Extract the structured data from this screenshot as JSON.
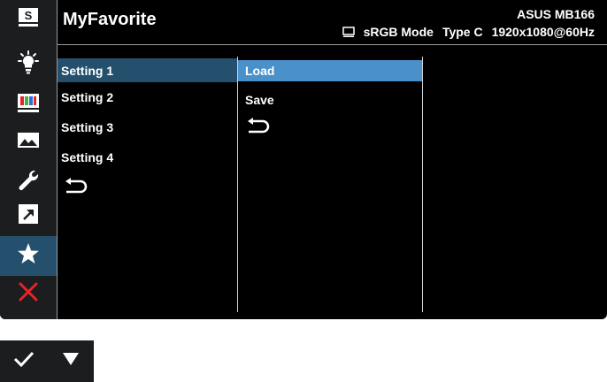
{
  "header": {
    "title": "MyFavorite",
    "model": "ASUS MB166",
    "mode": "sRGB Mode",
    "input": "Type C",
    "resolution": "1920x1080@60Hz"
  },
  "sidebar": {
    "items": [
      {
        "icon": "splendid-icon",
        "active": false
      },
      {
        "icon": "blue-light-filter-icon",
        "active": false
      },
      {
        "icon": "color-icon",
        "active": false
      },
      {
        "icon": "image-icon",
        "active": false
      },
      {
        "icon": "system-setup-icon",
        "active": false
      },
      {
        "icon": "shortcut-icon",
        "active": false
      },
      {
        "icon": "myfavorite-star-icon",
        "active": true
      },
      {
        "icon": "exit-icon",
        "active": false
      }
    ]
  },
  "menu": {
    "settings": [
      "Setting 1",
      "Setting 2",
      "Setting 3",
      "Setting 4"
    ],
    "selected_setting": "Setting 1",
    "actions": [
      "Load",
      "Save"
    ],
    "selected_action": "Load"
  },
  "bottom_bar": {
    "buttons": [
      {
        "icon": "confirm-check-icon"
      },
      {
        "icon": "down-arrow-icon"
      }
    ]
  },
  "colors": {
    "active_item": "#24506e",
    "selected_action": "#4a90c9",
    "exit": "#e8232a"
  }
}
